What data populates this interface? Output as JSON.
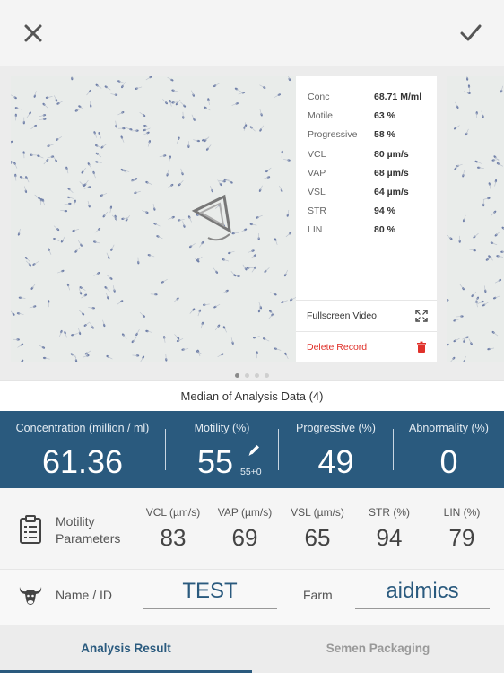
{
  "topbar": {
    "close_icon": "close-x-icon",
    "confirm_icon": "checkmark-icon"
  },
  "info": {
    "rows": [
      {
        "label": "Conc",
        "value": "68.71 M/ml"
      },
      {
        "label": "Motile",
        "value": "63 %"
      },
      {
        "label": "Progressive",
        "value": "58 %"
      },
      {
        "label": "VCL",
        "value": "80 µm/s"
      },
      {
        "label": "VAP",
        "value": "68 µm/s"
      },
      {
        "label": "VSL",
        "value": "64 µm/s"
      },
      {
        "label": "STR",
        "value": "94 %"
      },
      {
        "label": "LIN",
        "value": "80 %"
      }
    ],
    "fullscreen_label": "Fullscreen Video",
    "delete_label": "Delete Record"
  },
  "pager": {
    "count": 4,
    "active": 0
  },
  "median": {
    "title": "Median of Analysis Data (4)"
  },
  "summary": {
    "concentration": {
      "label": "Concentration (million / ml)",
      "value": "61.36"
    },
    "motility": {
      "label": "Motility (%)",
      "value": "55",
      "note": "55+0"
    },
    "progressive": {
      "label": "Progressive (%)",
      "value": "49"
    },
    "abnormality": {
      "label": "Abnormality (%)",
      "value": "0"
    }
  },
  "params": {
    "label_line1": "Motility",
    "label_line2": "Parameters",
    "columns": [
      {
        "header": "VCL (µm/s)",
        "value": "83"
      },
      {
        "header": "VAP (µm/s)",
        "value": "69"
      },
      {
        "header": "VSL (µm/s)",
        "value": "65"
      },
      {
        "header": "STR (%)",
        "value": "94"
      },
      {
        "header": "LIN (%)",
        "value": "79"
      }
    ]
  },
  "identity": {
    "name_label": "Name / ID",
    "name_value": "TEST",
    "farm_label": "Farm",
    "farm_value": "aidmics"
  },
  "tabs": [
    {
      "label": "Analysis Result",
      "active": true
    },
    {
      "label": "Semen Packaging",
      "active": false
    }
  ],
  "colors": {
    "primary": "#2a5a7e",
    "danger": "#e0312a",
    "background": "#f2f2f2"
  }
}
